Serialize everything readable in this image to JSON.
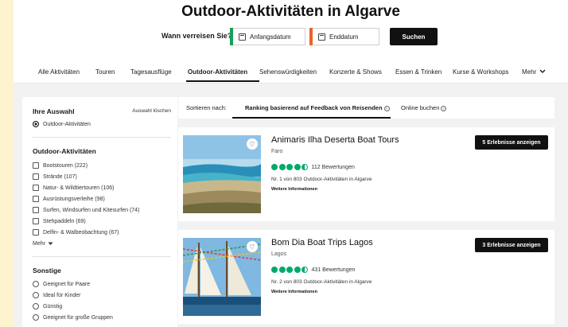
{
  "page": {
    "title": "Outdoor-Aktivitäten in Algarve"
  },
  "search": {
    "when_label": "Wann verreisen Sie?",
    "start_placeholder": "Anfangsdatum",
    "end_placeholder": "Enddatum",
    "button_label": "Suchen",
    "accent_start": "#13a05b",
    "accent_end": "#e8632b"
  },
  "tabs": [
    {
      "label": "Alle Aktivitäten"
    },
    {
      "label": "Touren"
    },
    {
      "label": "Tagesausflüge"
    },
    {
      "label": "Outdoor-Aktivitäten",
      "active": true
    },
    {
      "label": "Sehenswürdigkeiten"
    },
    {
      "label": "Konzerte & Shows"
    },
    {
      "label": "Essen & Trinken"
    },
    {
      "label": "Kurse & Workshops"
    },
    {
      "label": "Mehr"
    }
  ],
  "sidebar": {
    "selection_title": "Ihre Auswahl",
    "clear_label": "Auswahl löschen",
    "selected_filter": "Outdoor-Aktivitäten",
    "outdoor_title": "Outdoor-Aktivitäten",
    "outdoor_items": [
      "Bootstouren (222)",
      "Strände (107)",
      "Natur- & Wildtiertouren (106)",
      "Ausrüstungsverleihe (98)",
      "Surfen, Windsurfen und Kitesurfen (74)",
      "Stehpaddeln (69)",
      "Delfin- & Walbeobachtung (67)"
    ],
    "more_label": "Mehr",
    "other_title": "Sonstige",
    "other_items": [
      "Geeignet für Paare",
      "Ideal für Kinder",
      "Günstig",
      "Geeignet für große Gruppen"
    ]
  },
  "sort": {
    "label": "Sortieren nach:",
    "options": [
      "Ranking basierend auf Feedback von Reisenden",
      "Online buchen"
    ]
  },
  "icons": {
    "heart": "heart-icon",
    "calendar": "calendar-icon",
    "chevron": "chevron-down-icon",
    "info": "info-icon"
  },
  "listings": [
    {
      "name": "Animaris Ilha Deserta Boat Tours",
      "location": "Faro",
      "rating": 4.5,
      "reviews": "112 Bewertungen",
      "rank": "Nr. 1 von 803 Outdoor-Aktivitäten in Algarve",
      "more": "Weitere Informationen",
      "button": "5 Erlebnisse anzeigen"
    },
    {
      "name": "Bom Dia Boat Trips Lagos",
      "location": "Lagos",
      "rating": 4.5,
      "reviews": "431 Bewertungen",
      "rank": "Nr. 2 von 803 Outdoor-Aktivitäten in Algarve",
      "more": "Weitere Informationen",
      "button": "3 Erlebnisse anzeigen"
    }
  ]
}
